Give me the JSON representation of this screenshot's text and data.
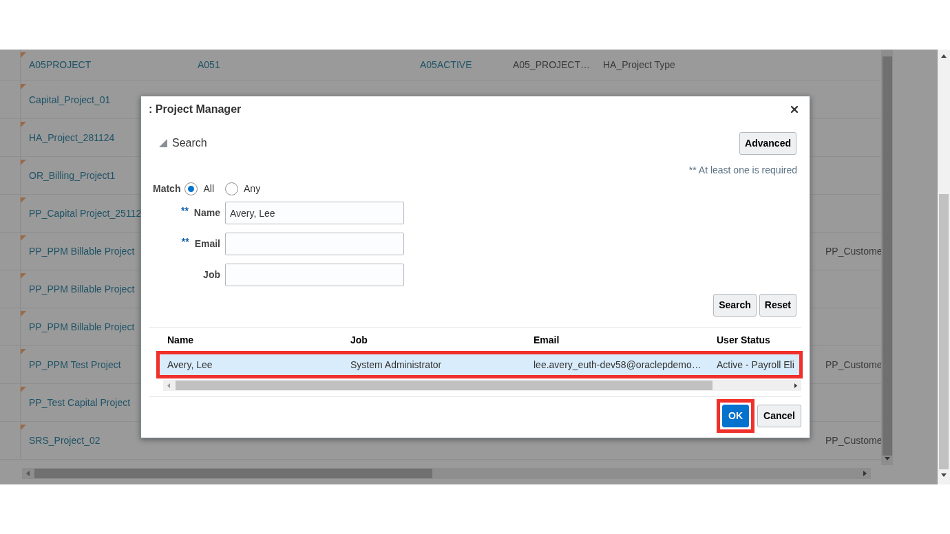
{
  "background_table": {
    "rows": [
      {
        "column_1": "A05PROJECT",
        "column_2": "A051",
        "column_3": "A05ACTIVE",
        "column_4": "A05_PROJECT…",
        "column_5": "HA_Project Type"
      },
      {
        "column_1": "Capital_Project_01"
      },
      {
        "column_1": "HA_Project_281124"
      },
      {
        "column_1": "OR_Billing_Project1"
      },
      {
        "column_1": "PP_Capital Project_25112"
      },
      {
        "column_1": "PP_PPM Billable Project",
        "column_7": "PP_Custome"
      },
      {
        "column_1": "PP_PPM Billable Project"
      },
      {
        "column_1": "PP_PPM Billable Project"
      },
      {
        "column_1": "PP_PPM Test Project",
        "column_7": "PP_Custome"
      },
      {
        "column_1": "PP_Test Capital Project"
      },
      {
        "column_1": "SRS_Project_02",
        "column_7": "PP_Custome"
      }
    ]
  },
  "dialog": {
    "title": ": Project Manager",
    "search_section": {
      "label": "Search",
      "expanded": true
    },
    "advanced_button": "Advanced",
    "required_note": "** At least one is required",
    "match": {
      "label": "Match",
      "options": [
        {
          "label": "All",
          "selected": true
        },
        {
          "label": "Any",
          "selected": false
        }
      ]
    },
    "fields": [
      {
        "marker": "**",
        "label": "Name",
        "value": "Avery, Lee"
      },
      {
        "marker": "**",
        "label": "Email"
      },
      {
        "label": "Job"
      }
    ],
    "search_buttons": [
      "Search",
      "Reset"
    ],
    "results": {
      "columns": [
        "Name",
        "Job",
        "Email",
        "User Status"
      ],
      "rows": [
        {
          "cells": [
            "Avery, Lee",
            "System Administrator",
            "lee.avery_euth-dev58@oraclepdemo…",
            "Active - Payroll Eli"
          ],
          "selected": true,
          "highlighted": true
        }
      ]
    },
    "footer_buttons": [
      {
        "label": "OK",
        "kind": "primary",
        "highlighted": true
      },
      {
        "label": "Cancel",
        "kind": "secondary"
      }
    ]
  }
}
